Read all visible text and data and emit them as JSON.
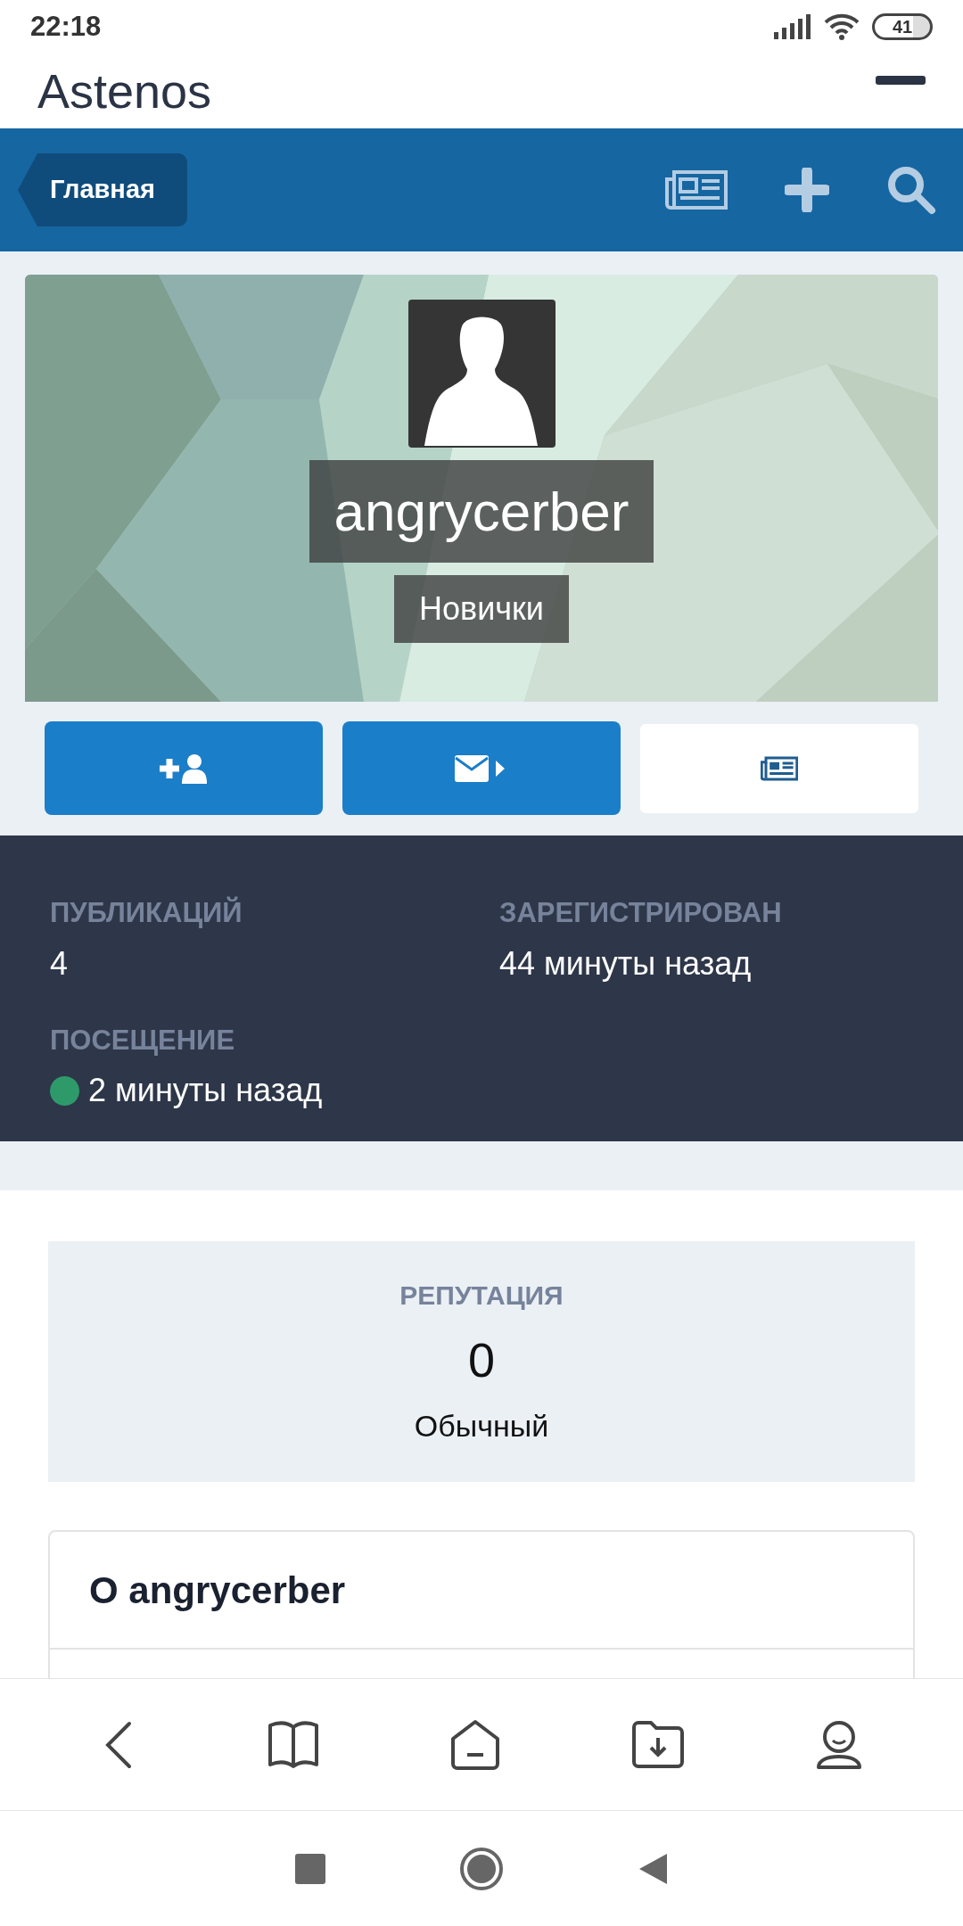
{
  "status_bar": {
    "time": "22:18",
    "battery": "41"
  },
  "site": {
    "logo": "Astenos"
  },
  "nav": {
    "breadcrumb": "Главная"
  },
  "profile": {
    "username": "angrycerber",
    "rank": "Новички"
  },
  "stats": [
    {
      "label": "ПУБЛИКАЦИЙ",
      "value": "4"
    },
    {
      "label": "ЗАРЕГИСТРИРОВАН",
      "value": "44 минуты назад"
    },
    {
      "label": "ПОСЕЩЕНИЕ",
      "value": "2 минуты назад",
      "online": true
    }
  ],
  "reputation": {
    "label": "РЕПУТАЦИЯ",
    "value": "0",
    "description": "Обычный"
  },
  "about": {
    "title": "О angrycerber"
  }
}
